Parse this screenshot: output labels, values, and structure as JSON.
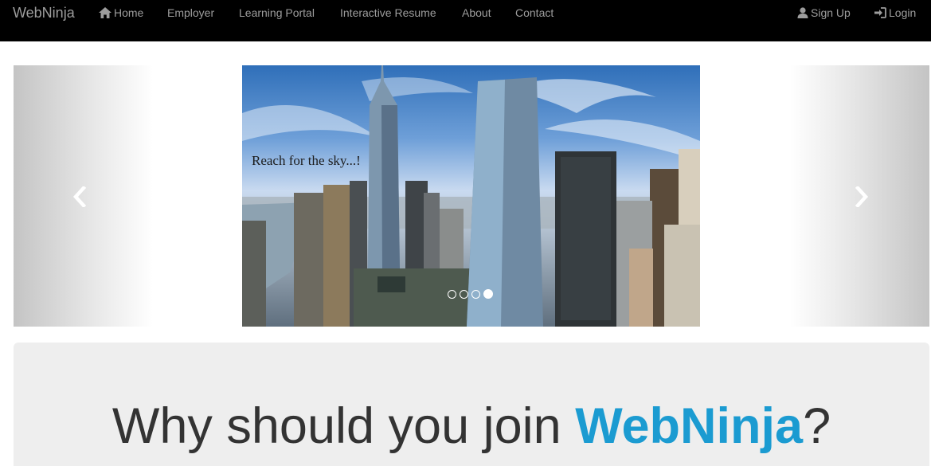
{
  "navbar": {
    "brand": "WebNinja",
    "links": [
      {
        "label": "Home",
        "icon": "home-icon"
      },
      {
        "label": "Employer"
      },
      {
        "label": "Learning Portal"
      },
      {
        "label": "Interactive Resume"
      },
      {
        "label": "About"
      },
      {
        "label": "Contact"
      }
    ],
    "right": [
      {
        "label": "Sign Up",
        "icon": "user-icon"
      },
      {
        "label": "Login",
        "icon": "login-icon"
      }
    ]
  },
  "carousel": {
    "caption": "Reach for the sky...!",
    "slide_count": 4,
    "active_index": 3,
    "prev_icon": "chevron-left-icon",
    "next_icon": "chevron-right-icon"
  },
  "jumbotron": {
    "headline_prefix": "Why should you join ",
    "headline_brand": "WebNinja",
    "headline_suffix": "?"
  },
  "colors": {
    "navbar_bg": "#000000",
    "nav_text": "#9d9d9d",
    "brand_accent": "#1b9bd1",
    "jumbotron_bg": "#eeeeee"
  }
}
